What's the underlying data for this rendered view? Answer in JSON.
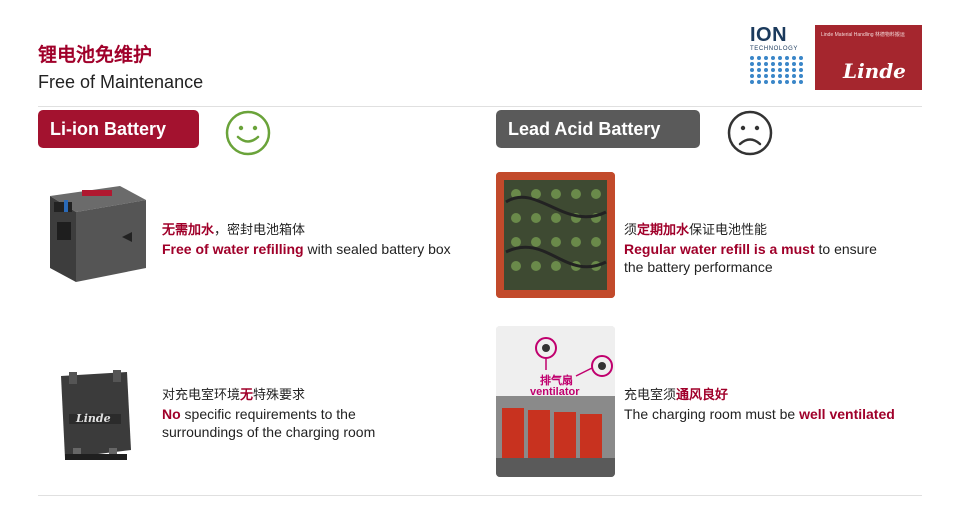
{
  "header": {
    "title_cn": "锂电池免维护",
    "title_en": "Free of Maintenance"
  },
  "logos": {
    "ion_text": "ION",
    "ion_sub": "TECHNOLOGY",
    "linde_small": "Linde Material Handling 林德物料搬运",
    "linde_word": "Linde"
  },
  "left": {
    "pill_label": "Li-ion Battery",
    "face_icon": "smiley-face-icon",
    "item1": {
      "cn_strong": "无需加水",
      "cn_rest": "，密封电池箱体",
      "en_strong": "Free of water refilling",
      "en_rest": " with sealed battery box"
    },
    "item2": {
      "cn_a": "对充电室环境",
      "cn_strong": "无",
      "cn_b": "特殊要求",
      "en_strong": "No",
      "en_rest_line1": " specific requirements to the",
      "en_rest_line2": "surroundings of the charging room"
    },
    "battery_badge": "Linde"
  },
  "right": {
    "pill_label": "Lead Acid Battery",
    "face_icon": "sad-face-icon",
    "item1": {
      "cn_a": "须",
      "cn_strong": "定期加水",
      "cn_b": "保证电池性能",
      "en_strong": "Regular water refill is a must",
      "en_rest_line1": " to ensure",
      "en_rest_line2": "the battery performance"
    },
    "item2": {
      "cn_a": "充电室须",
      "cn_strong": "通风良好",
      "en_a": "The charging room must be ",
      "en_strong": "well ventilated"
    },
    "annotation_cn": "排气扇",
    "annotation_en": "ventilator"
  },
  "colors": {
    "accent": "#a0002a",
    "pill_red": "#a3122f",
    "pill_gray": "#5a5a5a",
    "smile_green": "#6aa33a",
    "annotation_magenta": "#c0006e"
  }
}
